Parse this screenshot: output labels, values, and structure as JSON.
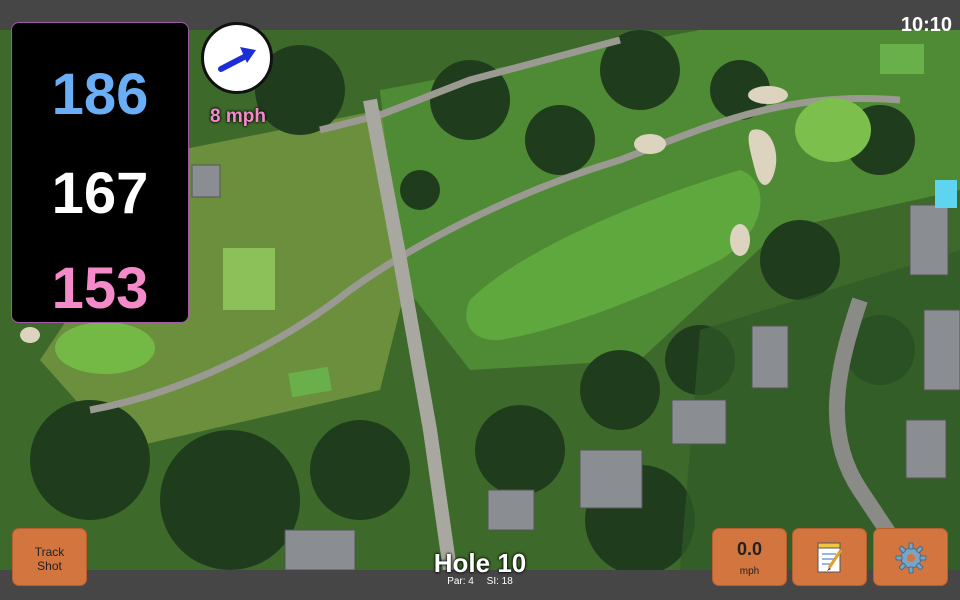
{
  "status": {
    "time": "10:10"
  },
  "distances": {
    "back": "186",
    "middle": "167",
    "front": "153"
  },
  "wind": {
    "speed_label": "8 mph",
    "direction_icon": "wind-arrow-icon"
  },
  "hole": {
    "title": "Hole 10",
    "par_label": "Par: 4",
    "si_label": "SI: 18"
  },
  "buttons": {
    "track_shot_line1": "Track",
    "track_shot_line2": "Shot",
    "speed_value": "0.0",
    "speed_unit": "mph",
    "notes_icon": "notepad-icon",
    "settings_icon": "gear-icon"
  },
  "colors": {
    "back_distance": "#6aaef5",
    "middle_distance": "#ffffff",
    "front_distance": "#f58acb",
    "button": "#d3753f"
  }
}
